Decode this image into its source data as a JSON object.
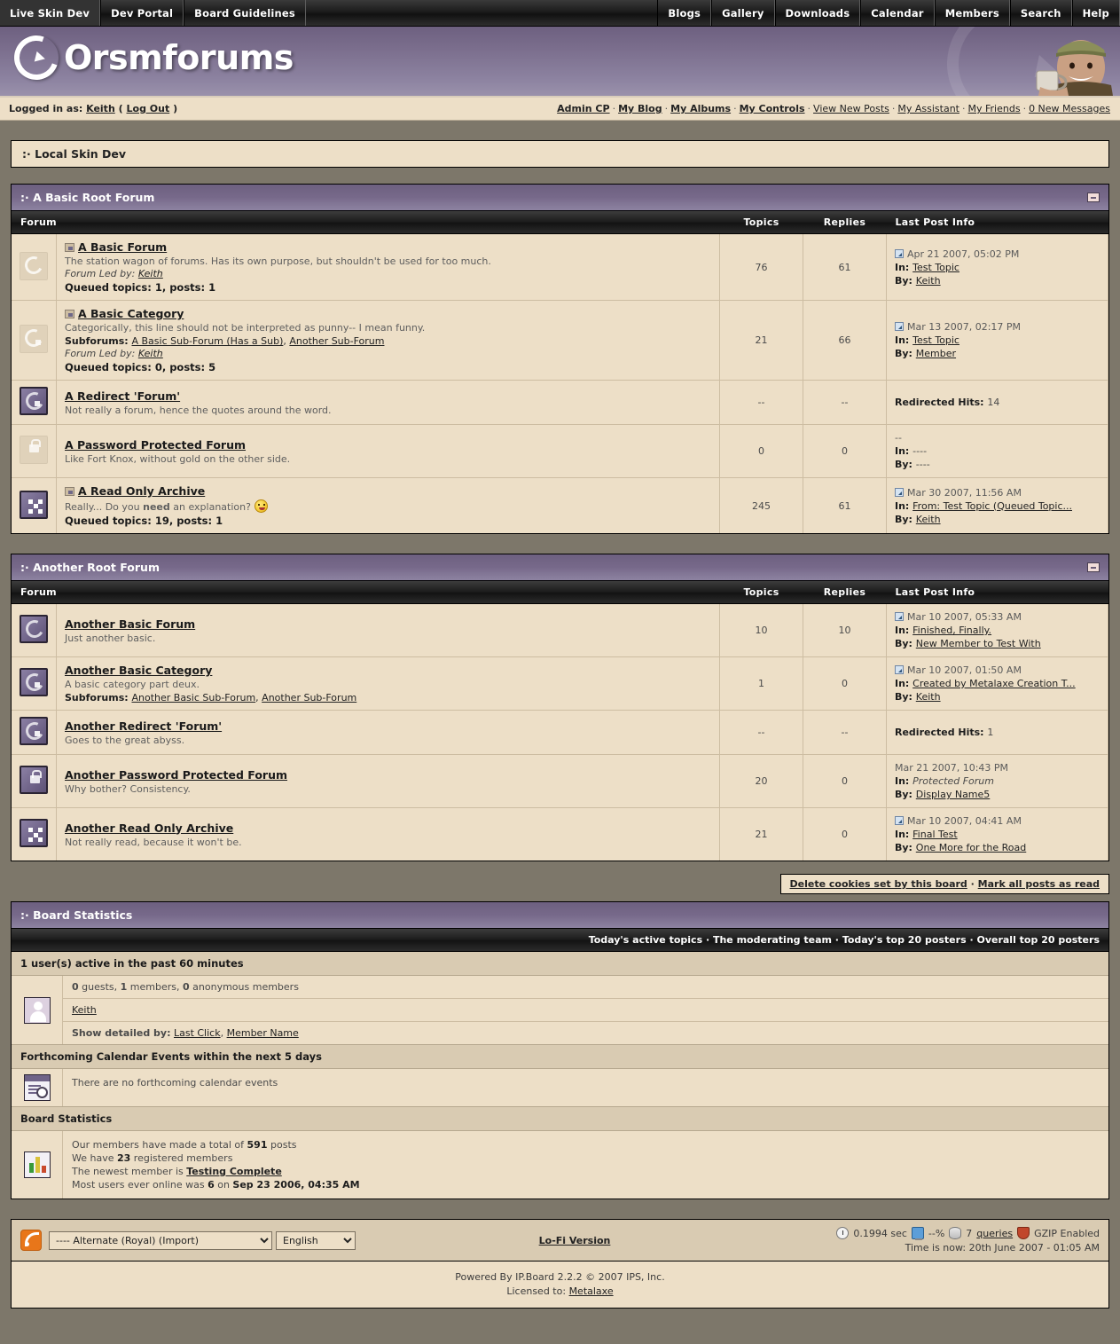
{
  "topnav": {
    "left": [
      "Live Skin Dev",
      "Dev Portal",
      "Board Guidelines"
    ],
    "right": [
      "Blogs",
      "Gallery",
      "Downloads",
      "Calendar",
      "Members",
      "Search",
      "Help"
    ]
  },
  "banner": {
    "logo_text": "Orsmforums"
  },
  "userbar": {
    "logged_label": "Logged in as:",
    "username": "Keith",
    "paren_open": "(",
    "logout": "Log Out",
    "paren_close": ")",
    "links": [
      "Admin CP",
      "My Blog",
      "My Albums",
      "My Controls",
      "View New Posts",
      "My Assistant",
      "My Friends",
      "0 New Messages"
    ]
  },
  "navstrip": {
    "label": ":· Local Skin Dev"
  },
  "columns": {
    "forum": "Forum",
    "topics": "Topics",
    "replies": "Replies",
    "lastpost": "Last Post Info"
  },
  "categories": [
    {
      "title": ":· A Basic Root Forum",
      "forums": [
        {
          "icon": "forum-icon-read",
          "has_topic_marker": true,
          "name": "A Basic Forum",
          "desc": "The station wagon of forums. Has its own purpose, but shouldn't be used for too much.",
          "subforums_label": "",
          "subforums": [],
          "led_label": "Forum Led by:",
          "led_by": "Keith",
          "queued": "Queued topics: 1, posts: 1",
          "topics": "76",
          "replies": "61",
          "last_type": "post",
          "last_date": "Apr 21 2007, 05:02 PM",
          "in_label": "In:",
          "in_value": "Test Topic",
          "by_label": "By:",
          "by_value": "Keith"
        },
        {
          "icon": "forum-icon-category-read",
          "has_topic_marker": true,
          "name": "A Basic Category",
          "desc": "Categorically, this line should not be interpreted as punny-- I mean funny.",
          "subforums_label": "Subforums:",
          "subforums": [
            "A Basic Sub-Forum (Has a Sub)",
            "Another Sub-Forum"
          ],
          "led_label": "Forum Led by:",
          "led_by": "Keith",
          "queued": "Queued topics: 0, posts: 5",
          "topics": "21",
          "replies": "66",
          "last_type": "post",
          "last_date": "Mar 13 2007, 02:17 PM",
          "in_label": "In:",
          "in_value": "Test Topic",
          "by_label": "By:",
          "by_value": "Member"
        },
        {
          "icon": "forum-icon-redirect",
          "has_topic_marker": false,
          "name": "A Redirect 'Forum'",
          "desc": "Not really a forum, hence the quotes around the word.",
          "subforums_label": "",
          "subforums": [],
          "led_label": "",
          "led_by": "",
          "queued": "",
          "topics": "--",
          "replies": "--",
          "last_type": "redirect",
          "redirect_label": "Redirected Hits:",
          "redirect_value": "14"
        },
        {
          "icon": "forum-icon-locked",
          "has_topic_marker": false,
          "name": "A Password Protected Forum",
          "desc": "Like Fort Knox, without gold on the other side.",
          "subforums_label": "",
          "subforums": [],
          "led_label": "",
          "led_by": "",
          "queued": "",
          "topics": "0",
          "replies": "0",
          "last_type": "empty",
          "last_date": "--",
          "in_label": "In:",
          "in_value": "----",
          "by_label": "By:",
          "by_value": "----"
        },
        {
          "icon": "forum-icon-archive",
          "has_topic_marker": true,
          "name": "A Read Only Archive",
          "desc_pre": "Really... Do you ",
          "desc_bold": "need",
          "desc_post": " an explanation?",
          "has_smiley": true,
          "desc": "",
          "subforums_label": "",
          "subforums": [],
          "led_label": "",
          "led_by": "",
          "queued": "Queued topics: 19, posts: 1",
          "topics": "245",
          "replies": "61",
          "last_type": "post",
          "last_date": "Mar 30 2007, 11:56 AM",
          "in_label": "In:",
          "in_value": "From: Test Topic (Queued Topic...",
          "by_label": "By:",
          "by_value": "Keith"
        }
      ]
    },
    {
      "title": ":· Another Root Forum",
      "forums": [
        {
          "icon": "forum-icon-unread",
          "has_topic_marker": false,
          "name": "Another Basic Forum",
          "desc": "Just another basic.",
          "subforums_label": "",
          "subforums": [],
          "led_label": "",
          "led_by": "",
          "queued": "",
          "topics": "10",
          "replies": "10",
          "last_type": "post",
          "last_date": "Mar 10 2007, 05:33 AM",
          "in_label": "In:",
          "in_value": "Finished, Finally.",
          "by_label": "By:",
          "by_value": "New Member to Test With"
        },
        {
          "icon": "forum-icon-category-unread",
          "has_topic_marker": false,
          "name": "Another Basic Category",
          "desc": "A basic category part deux.",
          "subforums_label": "Subforums:",
          "subforums": [
            "Another Basic Sub-Forum",
            "Another Sub-Forum"
          ],
          "led_label": "",
          "led_by": "",
          "queued": "",
          "topics": "1",
          "replies": "0",
          "last_type": "post",
          "last_date": "Mar 10 2007, 01:50 AM",
          "in_label": "In:",
          "in_value": "Created by Metalaxe Creation T...",
          "by_label": "By:",
          "by_value": "Keith"
        },
        {
          "icon": "forum-icon-redirect",
          "has_topic_marker": false,
          "name": "Another Redirect 'Forum'",
          "desc": "Goes to the great abyss.",
          "subforums_label": "",
          "subforums": [],
          "led_label": "",
          "led_by": "",
          "queued": "",
          "topics": "--",
          "replies": "--",
          "last_type": "redirect",
          "redirect_label": "Redirected Hits:",
          "redirect_value": "1"
        },
        {
          "icon": "forum-icon-locked-unread",
          "has_topic_marker": false,
          "name": "Another Password Protected Forum",
          "desc": "Why bother? Consistency.",
          "subforums_label": "",
          "subforums": [],
          "led_label": "",
          "led_by": "",
          "queued": "",
          "topics": "20",
          "replies": "0",
          "last_type": "protected",
          "last_date": "Mar 21 2007, 10:43 PM",
          "in_label": "In:",
          "in_value": "Protected Forum",
          "by_label": "By:",
          "by_value": "Display Name5"
        },
        {
          "icon": "forum-icon-archive-unread",
          "has_topic_marker": false,
          "name": "Another Read Only Archive",
          "desc": "Not really read, because it won't be.",
          "subforums_label": "",
          "subforums": [],
          "led_label": "",
          "led_by": "",
          "queued": "",
          "topics": "21",
          "replies": "0",
          "last_type": "post",
          "last_date": "Mar 10 2007, 04:41 AM",
          "in_label": "In:",
          "in_value": "Final Test",
          "by_label": "By:",
          "by_value": "One More for the Road"
        }
      ]
    }
  ],
  "actionbar": {
    "delete_cookies": "Delete cookies set by this board",
    "separator": "·",
    "mark_read": "Mark all posts as read"
  },
  "board_stats": {
    "title": ":· Board Statistics",
    "sublinks": [
      "Today's active topics",
      "The moderating team",
      "Today's top 20 posters",
      "Overall top 20 posters"
    ],
    "active_header": "1 user(s) active in the past 60 minutes",
    "guests_line_pre": "0",
    "guests_line": " guests, ",
    "members_count": "1",
    "members_word": " members, ",
    "anon_count": "0",
    "anon_word": " anonymous members",
    "active_user": "Keith",
    "show_detailed_label": "Show detailed by:",
    "show_detailed_a": "Last Click",
    "show_detailed_comma": ",",
    "show_detailed_b": "Member Name",
    "calendar_header": "Forthcoming Calendar Events within the next 5 days",
    "calendar_empty": "There are no forthcoming calendar events",
    "stats_header": "Board Statistics",
    "line1_pre": "Our members have made a total of ",
    "line1_num": "591",
    "line1_post": " posts",
    "line2_pre": "We have ",
    "line2_num": "23",
    "line2_post": " registered members",
    "line3_pre": "The newest member is ",
    "line3_link": "Testing Complete",
    "line4_pre": "Most users ever online was ",
    "line4_num": "6",
    "line4_mid": " on ",
    "line4_date": "Sep 23 2006, 04:35 AM"
  },
  "footer": {
    "skin_selected": "---- Alternate (Royal) (Import)",
    "skin_options": [
      "---- Alternate (Royal) (Import)"
    ],
    "lang_selected": "English",
    "lang_options": [
      "English"
    ],
    "lofi": "Lo-Fi Version",
    "exec_time": "0.1994 sec",
    "load_pct": "--%",
    "queries_count": "7",
    "queries_label": "queries",
    "gzip": "GZIP Enabled",
    "time_now": "Time is now: 20th June 2007 - 01:05 AM",
    "powered": "Powered By IP.Board 2.2.2 © 2007  IPS, Inc.",
    "licensed_label": "Licensed to:",
    "licensed_to": "Metalaxe"
  }
}
